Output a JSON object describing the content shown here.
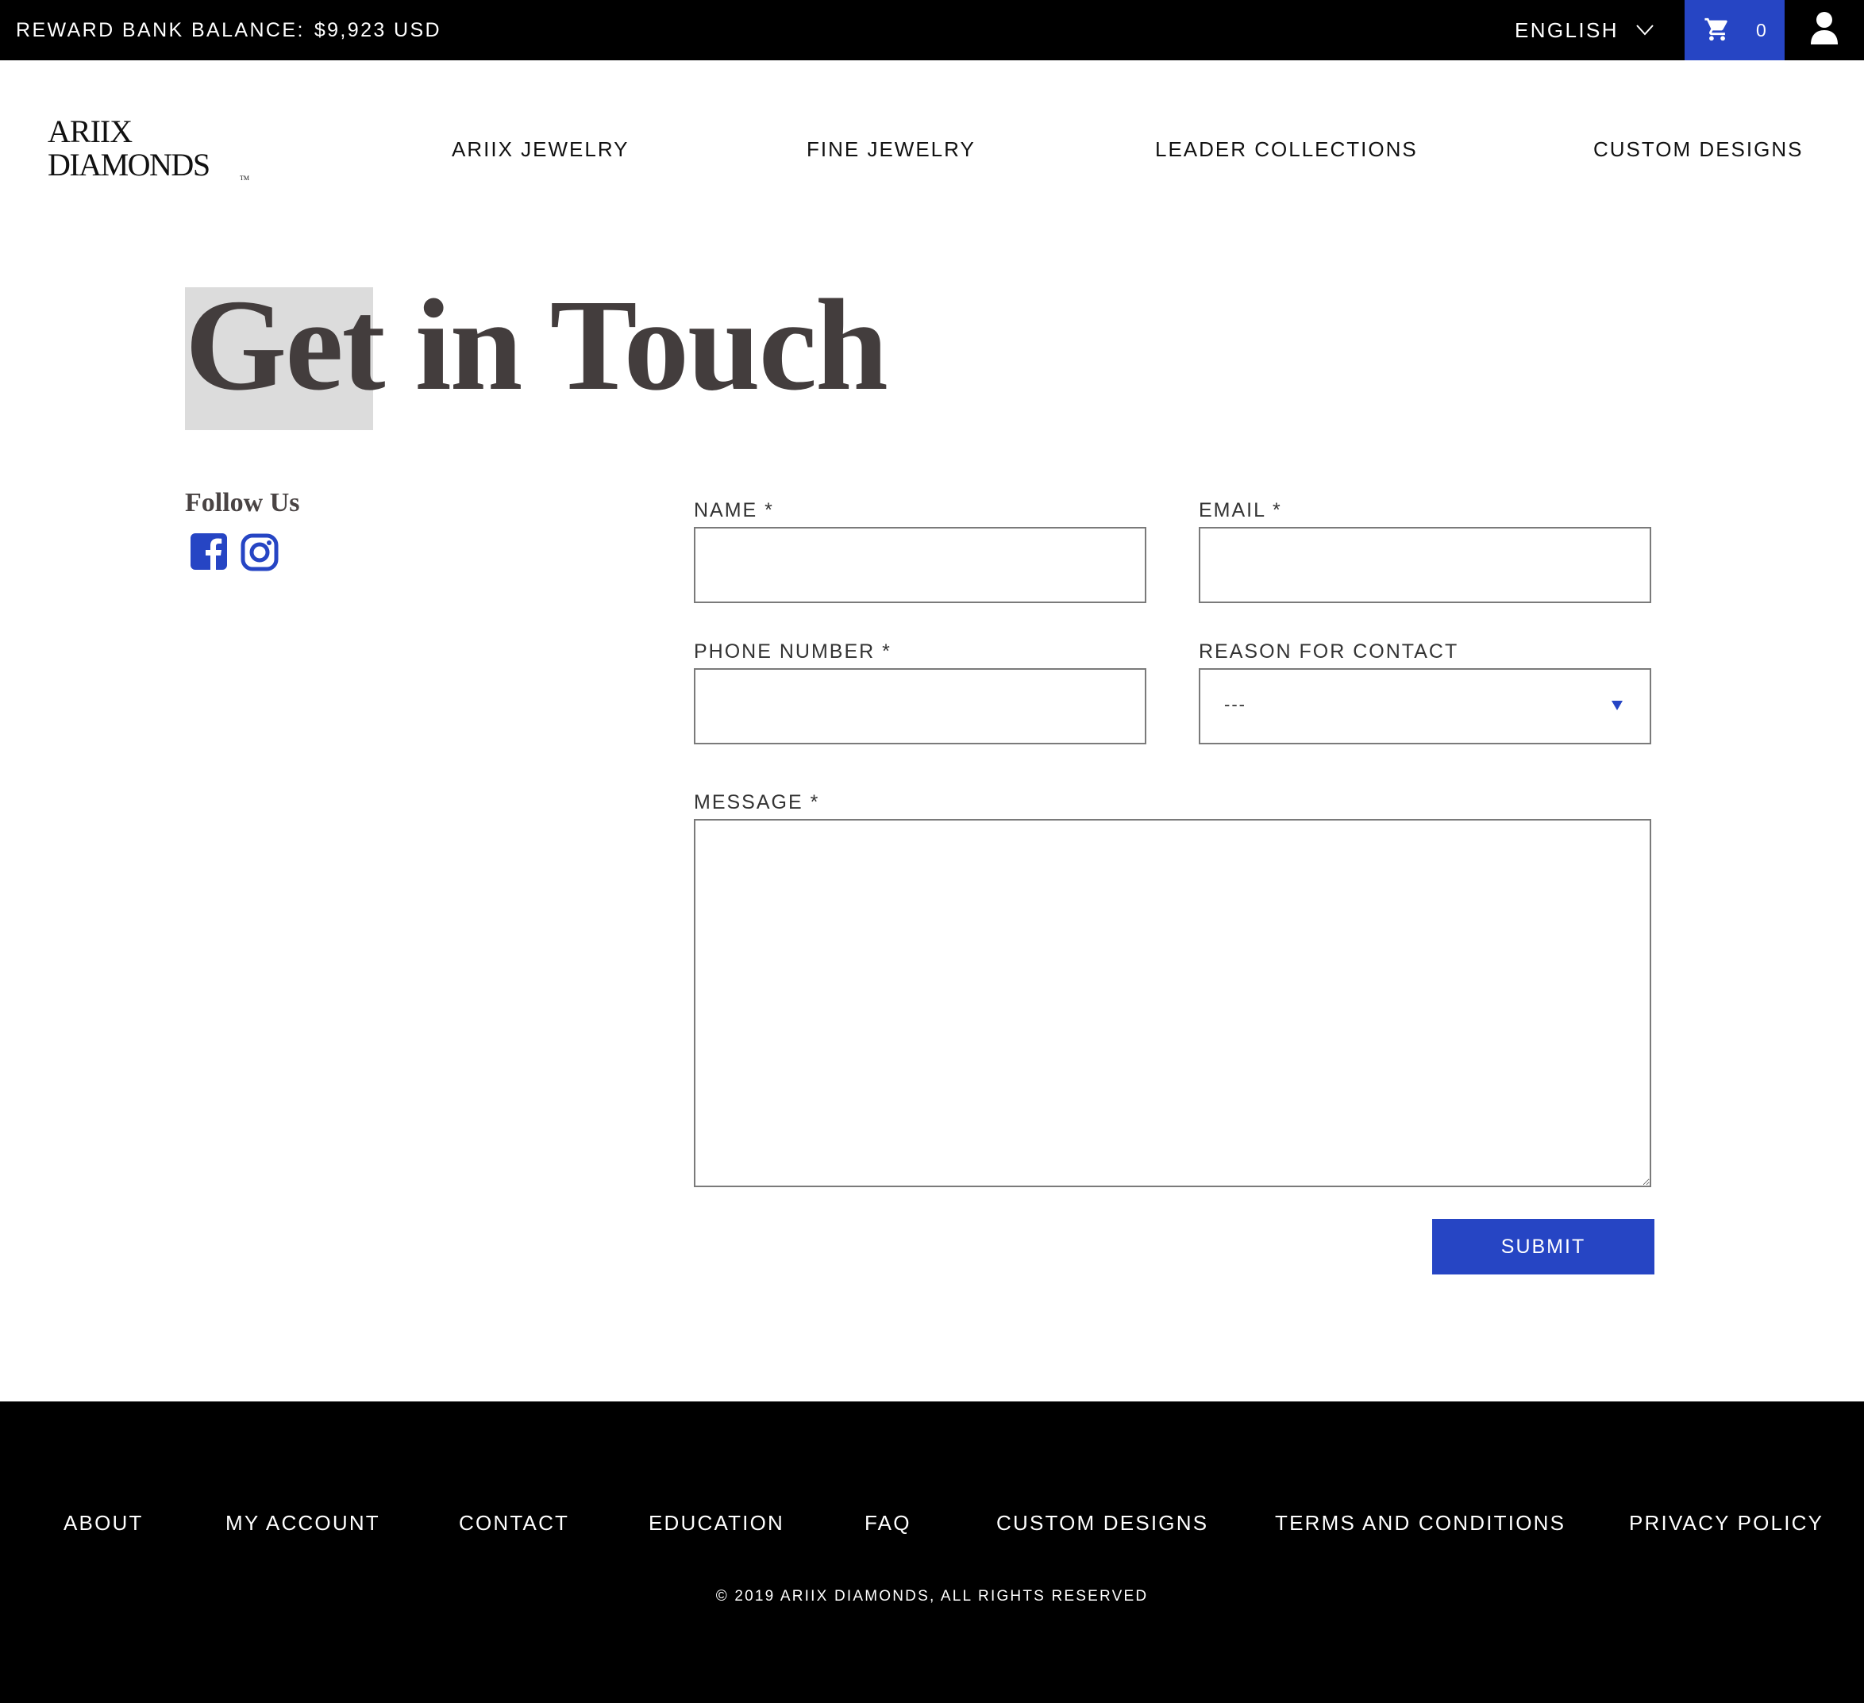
{
  "topbar": {
    "reward_label": "REWARD BANK BALANCE:",
    "reward_amount": "$9,923 USD",
    "language": "ENGLISH",
    "cart_count": "0",
    "icons": {
      "cart": "cart-icon",
      "user": "user-icon",
      "chevron": "chevron-down-icon"
    }
  },
  "header": {
    "logo_line1": "ARIIX",
    "logo_line2": "DIAMONDS",
    "logo_tm": "TM",
    "nav": [
      "ARIIX JEWELRY",
      "FINE JEWELRY",
      "LEADER COLLECTIONS",
      "CUSTOM DESIGNS"
    ]
  },
  "page": {
    "title_highlight": "Get",
    "title_rest": "in Touch",
    "highlight_color": "#dcdcdc"
  },
  "follow": {
    "label": "Follow Us",
    "icons": [
      "facebook-icon",
      "instagram-icon"
    ]
  },
  "form": {
    "name_label": "NAME *",
    "name_value": "",
    "email_label": "EMAIL *",
    "email_value": "",
    "phone_label": "PHONE NUMBER *",
    "phone_value": "",
    "reason_label": "REASON FOR CONTACT",
    "reason_value": "---",
    "message_label": "MESSAGE *",
    "message_value": "",
    "submit_label": "SUBMIT"
  },
  "footer": {
    "links": [
      "ABOUT",
      "MY ACCOUNT",
      "CONTACT",
      "EDUCATION",
      "FAQ",
      "CUSTOM DESIGNS",
      "TERMS AND CONDITIONS",
      "PRIVACY POLICY"
    ],
    "copyright": "© 2019 ARIIX DIAMONDS,   ALL RIGHTS RESERVED"
  },
  "colors": {
    "accent": "#2645c4",
    "topbar_bg": "#000000",
    "footer_bg": "#000000",
    "title_text": "#433d3d"
  }
}
